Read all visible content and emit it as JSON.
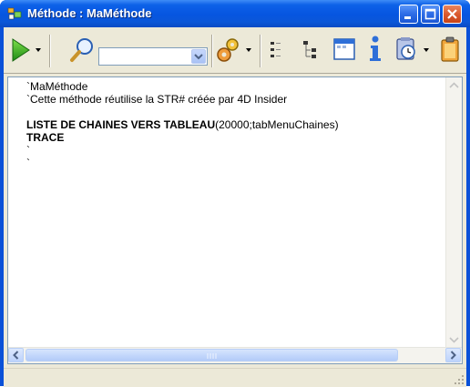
{
  "window": {
    "title": "Méthode : MaMéthode",
    "accent": "#0a51d8"
  },
  "toolbar": {
    "buttons": [
      {
        "name": "run-icon"
      },
      {
        "name": "run-dropdown-arrow"
      },
      {
        "name": "search-icon"
      },
      {
        "name": "method-dropdown"
      },
      {
        "name": "gear-icon"
      },
      {
        "name": "gear-dropdown-arrow"
      },
      {
        "name": "list-icon"
      },
      {
        "name": "tree-icon"
      },
      {
        "name": "form-icon"
      },
      {
        "name": "info-icon"
      },
      {
        "name": "clock-icon"
      },
      {
        "name": "clock-dropdown-arrow"
      },
      {
        "name": "clipboard-icon"
      }
    ],
    "combo_value": ""
  },
  "editor": {
    "lines": [
      {
        "text": "`MaMéthode",
        "bold": false
      },
      {
        "text": "`Cette méthode réutilise la STR# créée par 4D Insider",
        "bold": false
      },
      {
        "text": "",
        "bold": false
      },
      {
        "text": "LISTE DE CHAINES VERS TABLEAU",
        "bold": true,
        "rest": "(20000;tabMenuChaines)"
      },
      {
        "text": "TRACE",
        "bold": true
      },
      {
        "text": "`",
        "bold": false
      },
      {
        "text": "`",
        "bold": false
      }
    ]
  },
  "statusbar": {
    "text": ""
  }
}
